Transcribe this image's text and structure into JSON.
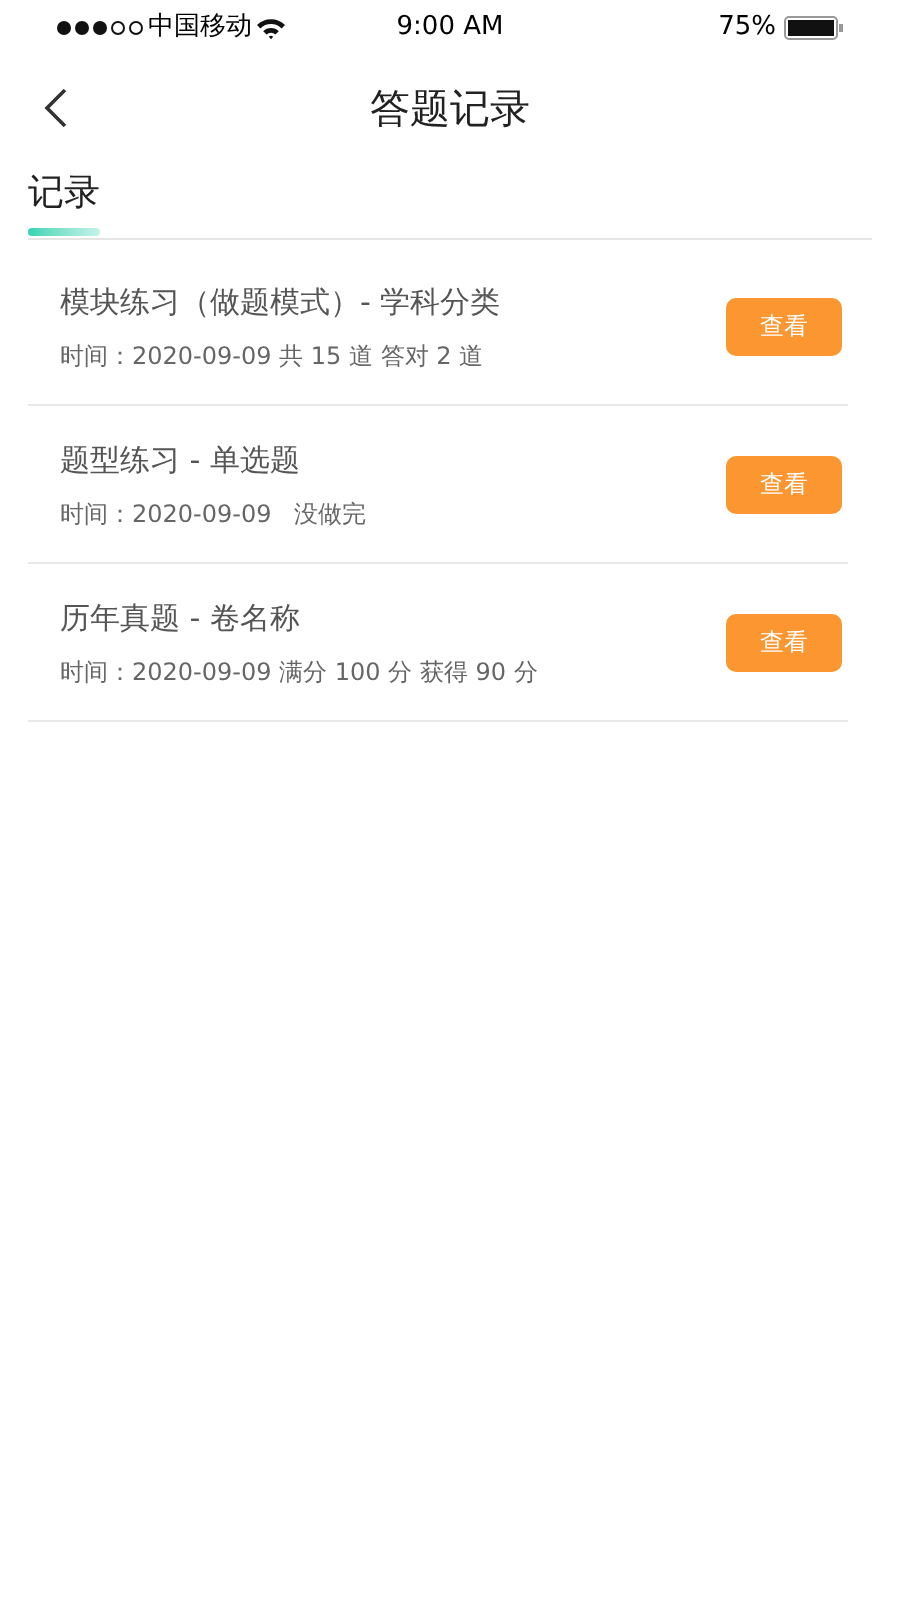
{
  "status_bar": {
    "carrier": "中国移动",
    "time": "9:00 AM",
    "battery": "75%"
  },
  "nav": {
    "title": "答题记录"
  },
  "tabs": [
    {
      "label": "记录",
      "selected": true
    }
  ],
  "records": [
    {
      "title": "模块练习（做题模式）- 学科分类",
      "detail": "时间：2020-09-09 共 15 道 答对 2 道",
      "button": "查看"
    },
    {
      "title": "题型练习 - 单选题",
      "detail": "时间：2020-09-09   没做完",
      "button": "查看"
    },
    {
      "title": "历年真题 - 卷名称",
      "detail": "时间：2020-09-09 满分 100 分 获得 90 分",
      "button": "查看"
    }
  ]
}
